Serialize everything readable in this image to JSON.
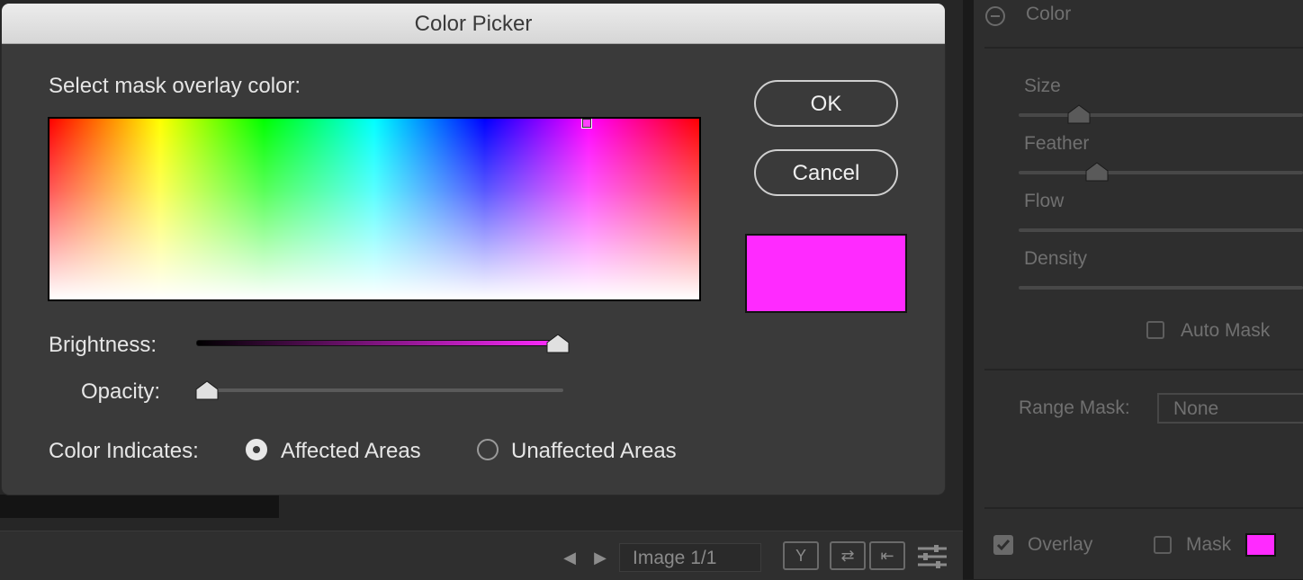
{
  "dialog": {
    "title": "Color Picker",
    "prompt": "Select mask overlay color:",
    "ok_label": "OK",
    "cancel_label": "Cancel",
    "selected_color": "#ff2aff",
    "brightness_label": "Brightness:",
    "brightness_level": 1.0,
    "opacity_label": "Opacity:",
    "opacity_level": 0.0,
    "color_indicates_label": "Color Indicates:",
    "options": [
      {
        "label": "Affected Areas",
        "selected": true
      },
      {
        "label": "Unaffected Areas",
        "selected": false
      }
    ]
  },
  "right_panel": {
    "section_title": "Color",
    "sliders": [
      {
        "label": "Size"
      },
      {
        "label": "Feather"
      },
      {
        "label": "Flow"
      },
      {
        "label": "Density"
      }
    ],
    "auto_mask_label": "Auto Mask",
    "range_mask_label": "Range Mask:",
    "range_mask_value": "None",
    "overlay_label": "Overlay",
    "mask_label": "Mask",
    "mask_swatch_color": "#ff2aff"
  },
  "toolbar": {
    "image_counter": "Image 1/1",
    "icons": [
      "y-compare-icon",
      "swap-icon",
      "copy-left-icon",
      "filter-sliders-icon"
    ]
  }
}
